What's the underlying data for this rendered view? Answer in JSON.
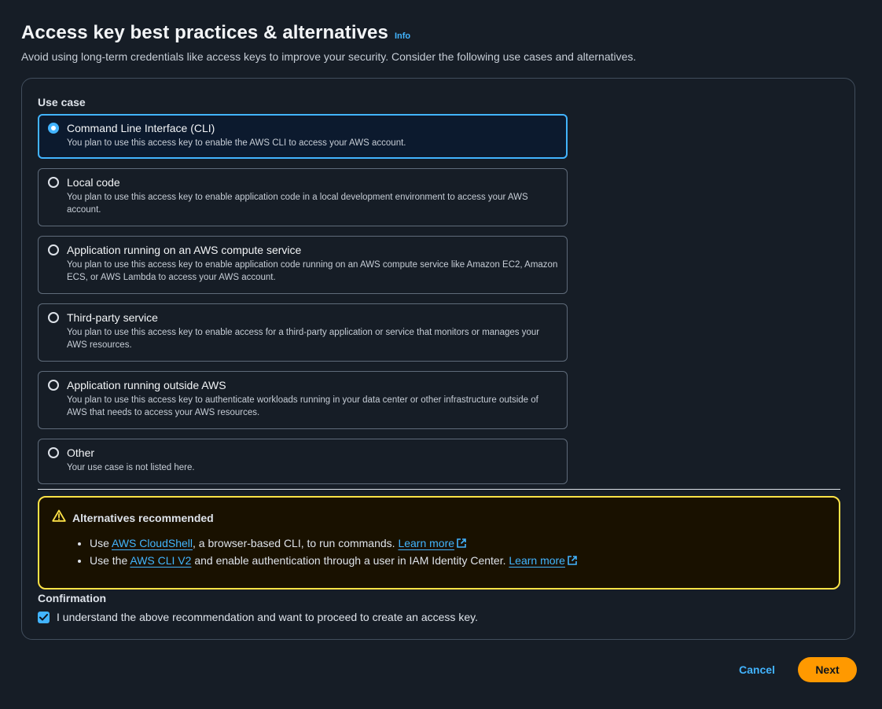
{
  "header": {
    "title": "Access key best practices & alternatives",
    "info_link": "Info",
    "subtitle": "Avoid using long-term credentials like access keys to improve your security. Consider the following use cases and alternatives."
  },
  "use_case": {
    "label": "Use case",
    "selected_index": 0,
    "options": [
      {
        "title": "Command Line Interface (CLI)",
        "description": "You plan to use this access key to enable the AWS CLI to access your AWS account."
      },
      {
        "title": "Local code",
        "description": "You plan to use this access key to enable application code in a local development environment to access your AWS account."
      },
      {
        "title": "Application running on an AWS compute service",
        "description": "You plan to use this access key to enable application code running on an AWS compute service like Amazon EC2, Amazon ECS, or AWS Lambda to access your AWS account."
      },
      {
        "title": "Third-party service",
        "description": "You plan to use this access key to enable access for a third-party application or service that monitors or manages your AWS resources."
      },
      {
        "title": "Application running outside AWS",
        "description": "You plan to use this access key to authenticate workloads running in your data center or other infrastructure outside of AWS that needs to access your AWS resources."
      },
      {
        "title": "Other",
        "description": "Your use case is not listed here."
      }
    ]
  },
  "alert": {
    "icon": "warning-icon",
    "title": "Alternatives recommended",
    "item1": {
      "prefix": "Use ",
      "link": "AWS CloudShell",
      "text": ", a browser-based CLI, to run commands. ",
      "learn_more": "Learn more"
    },
    "item2": {
      "prefix": "Use the ",
      "link": "AWS CLI V2",
      "text": " and enable authentication through a user in IAM Identity Center. ",
      "learn_more": "Learn more"
    }
  },
  "confirmation": {
    "label": "Confirmation",
    "checked": true,
    "text": "I understand the above recommendation and want to proceed to create an access key."
  },
  "actions": {
    "cancel_label": "Cancel",
    "next_label": "Next"
  },
  "colors": {
    "background": "#161d26",
    "accent": "#42b4ff",
    "warning_border": "#ffe347",
    "primary_button": "#ff9900"
  }
}
